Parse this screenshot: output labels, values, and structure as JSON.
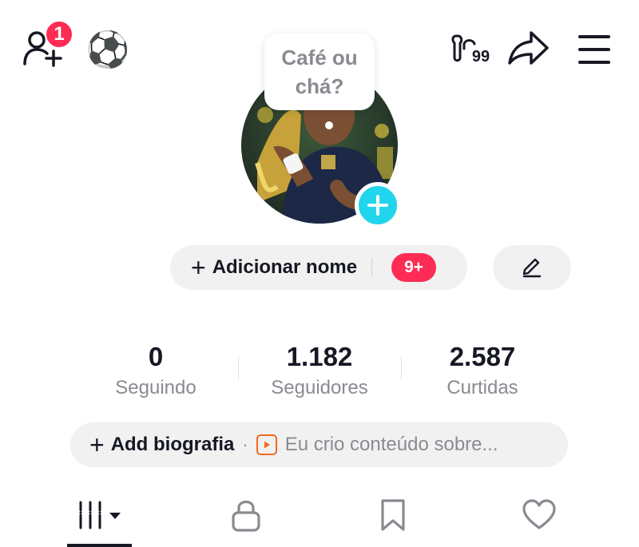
{
  "header": {
    "notification_count": "1",
    "emoji": "⚽",
    "badge_count": "99",
    "icons": [
      "add-friend-icon",
      "soccer-ball-icon",
      "badge-icon",
      "share-icon",
      "menu-icon"
    ]
  },
  "profile": {
    "status_bubble": "Café ou chá?",
    "avatar_action_icon": "plus-icon",
    "add_name_label": "Adicionar nome",
    "name_badge": "9+",
    "edit_icon": "pencil-icon"
  },
  "stats": [
    {
      "value": "0",
      "label": "Seguindo"
    },
    {
      "value": "1.182",
      "label": "Seguidores"
    },
    {
      "value": "2.587",
      "label": "Curtidas"
    }
  ],
  "bio": {
    "add_label": "Add biografia",
    "separator": "·",
    "hint": "Eu crio conteúdo sobre..."
  },
  "tabs": [
    {
      "icon": "videos-grid-icon",
      "active": true
    },
    {
      "icon": "lock-icon",
      "active": false
    },
    {
      "icon": "bookmark-icon",
      "active": false
    },
    {
      "icon": "heart-icon",
      "active": false
    }
  ],
  "colors": {
    "accent": "#fe2c55",
    "avatar_add": "#20d5ec",
    "pill_bg": "#f1f1f2",
    "secondary_text": "#8a8b91",
    "bio_play": "#f26a21"
  }
}
